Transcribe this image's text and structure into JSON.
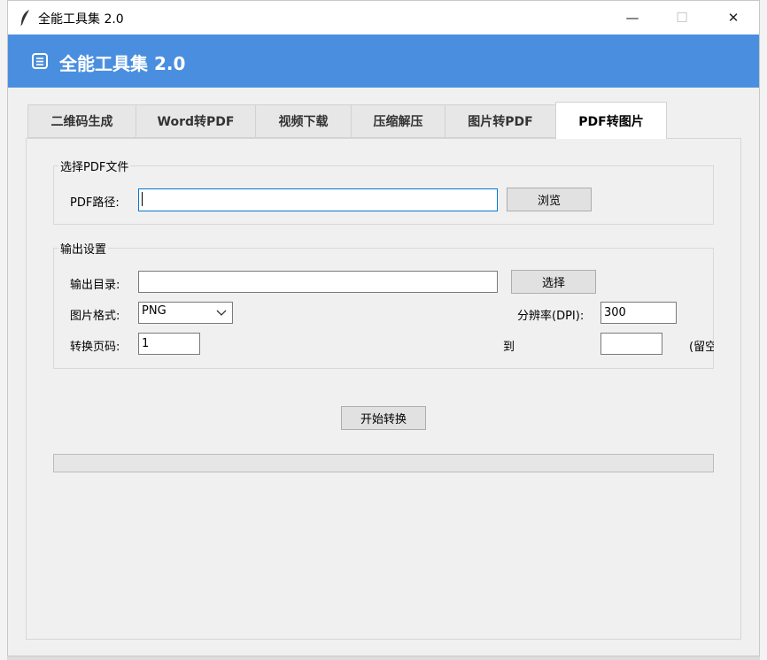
{
  "window": {
    "title": "全能工具集 2.0",
    "controls": {
      "minimize": "—",
      "maximize": "☐",
      "close": "✕"
    }
  },
  "header": {
    "title": "全能工具集 2.0",
    "icon": "document-stack-icon",
    "color": "#4a8fdf"
  },
  "tabs": [
    {
      "label": "二维码生成"
    },
    {
      "label": "Word转PDF"
    },
    {
      "label": "视频下载"
    },
    {
      "label": "压缩解压"
    },
    {
      "label": "图片转PDF"
    },
    {
      "label": "PDF转图片",
      "active": true
    }
  ],
  "select_pdf": {
    "group_label": "选择PDF文件",
    "path_label": "PDF路径:",
    "path_value": "",
    "browse_label": "浏览"
  },
  "output": {
    "group_label": "输出设置",
    "dir_label": "输出目录:",
    "dir_value": "",
    "choose_label": "选择",
    "format_label": "图片格式:",
    "format_value": "PNG",
    "dpi_label": "分辨率(DPI):",
    "dpi_value": "300",
    "pages_label": "转换页码:",
    "page_from": "1",
    "to_label": "到",
    "page_to": "",
    "hint": "(留空"
  },
  "start_label": "开始转换",
  "progress": {
    "value": 0
  }
}
